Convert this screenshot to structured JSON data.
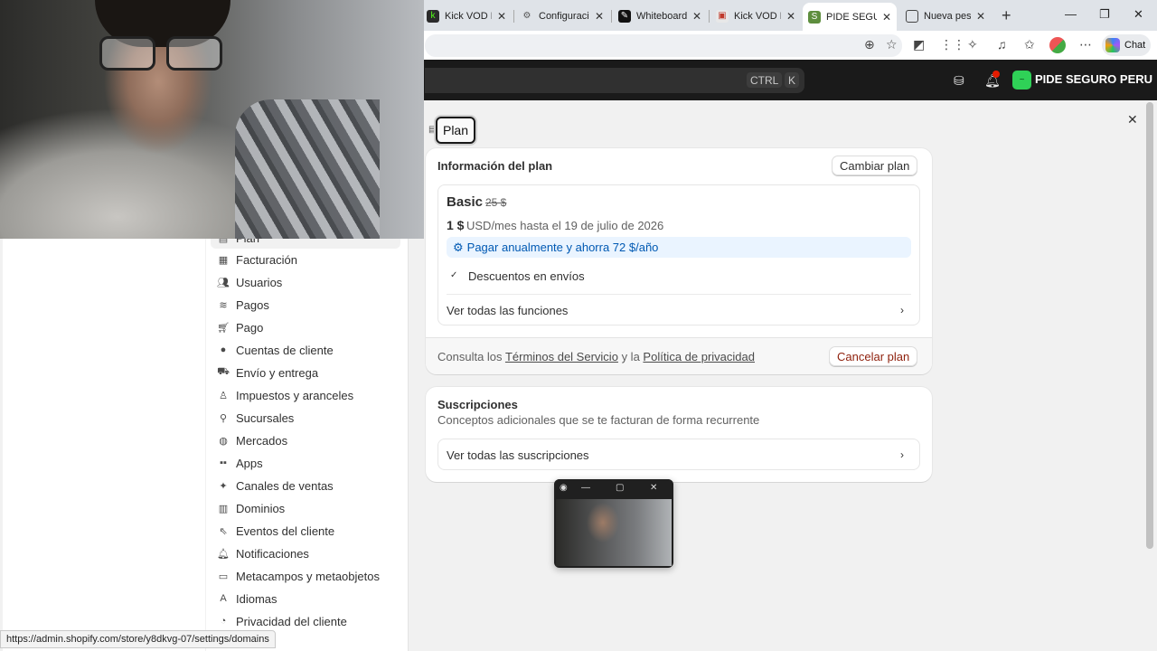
{
  "browser": {
    "tabs": [
      {
        "label": "Kick VOD Do",
        "icon": "kick-icon",
        "color": "#53fc18"
      },
      {
        "label": "Configuración",
        "icon": "gear-icon",
        "color": "#555555"
      },
      {
        "label": "Whiteboard",
        "icon": "whiteboard-icon",
        "color": "#111111"
      },
      {
        "label": "Kick VOD Do",
        "icon": "kick-icon",
        "color": "#53fc18"
      },
      {
        "label": "PIDE SEGURO",
        "icon": "shopify-icon",
        "color": "#5e8e3e"
      },
      {
        "label": "Nueva pestañ",
        "icon": "newtab-icon",
        "color": "#4a6fe3"
      }
    ],
    "chat_label": "Chat",
    "status_url": "https://admin.shopify.com/store/y8dkvg-07/settings/domains"
  },
  "shopify": {
    "search_shortcut_1": "CTRL",
    "search_shortcut_2": "K",
    "store_name": "PIDE SEGURO PERU",
    "notification_count": "1"
  },
  "nav": {
    "items": [
      {
        "label": "Plan",
        "icon": "plan-icon"
      },
      {
        "label": "Facturación",
        "icon": "billing-icon"
      },
      {
        "label": "Usuarios",
        "icon": "users-icon"
      },
      {
        "label": "Pagos",
        "icon": "payments-icon"
      },
      {
        "label": "Pago",
        "icon": "cart-icon"
      },
      {
        "label": "Cuentas de cliente",
        "icon": "customer-icon"
      },
      {
        "label": "Envío y entrega",
        "icon": "truck-icon"
      },
      {
        "label": "Impuestos y aranceles",
        "icon": "taxes-icon"
      },
      {
        "label": "Sucursales",
        "icon": "location-icon"
      },
      {
        "label": "Mercados",
        "icon": "globe-icon"
      },
      {
        "label": "Apps",
        "icon": "apps-icon"
      },
      {
        "label": "Canales de ventas",
        "icon": "channels-icon"
      },
      {
        "label": "Dominios",
        "icon": "domains-icon"
      },
      {
        "label": "Eventos del cliente",
        "icon": "cursor-icon"
      },
      {
        "label": "Notificaciones",
        "icon": "bell-icon"
      },
      {
        "label": "Metacampos y metaobjetos",
        "icon": "metafields-icon"
      },
      {
        "label": "Idiomas",
        "icon": "languages-icon"
      },
      {
        "label": "Privacidad del cliente",
        "icon": "privacy-icon"
      }
    ]
  },
  "plan": {
    "title": "Plan",
    "info_heading": "Información del plan",
    "change_button": "Cambiar plan",
    "plan_name": "Basic",
    "old_price": "25 $",
    "price": "1 $",
    "price_detail": "USD/mes hasta el 19 de julio de 2026",
    "annual_offer": "Pagar anualmente y ahorra 72 $/año",
    "feature": "Descuentos en envíos",
    "see_all_features": "Ver todas las funciones",
    "terms_prefix": "Consulta los",
    "terms_link": "Términos del Servicio",
    "terms_and": "y la",
    "privacy_link": "Política de privacidad",
    "cancel_button": "Cancelar plan"
  },
  "subscriptions": {
    "heading": "Suscripciones",
    "description": "Conceptos adicionales que se te facturan de forma recurrente",
    "see_all": "Ver todas las suscripciones"
  }
}
